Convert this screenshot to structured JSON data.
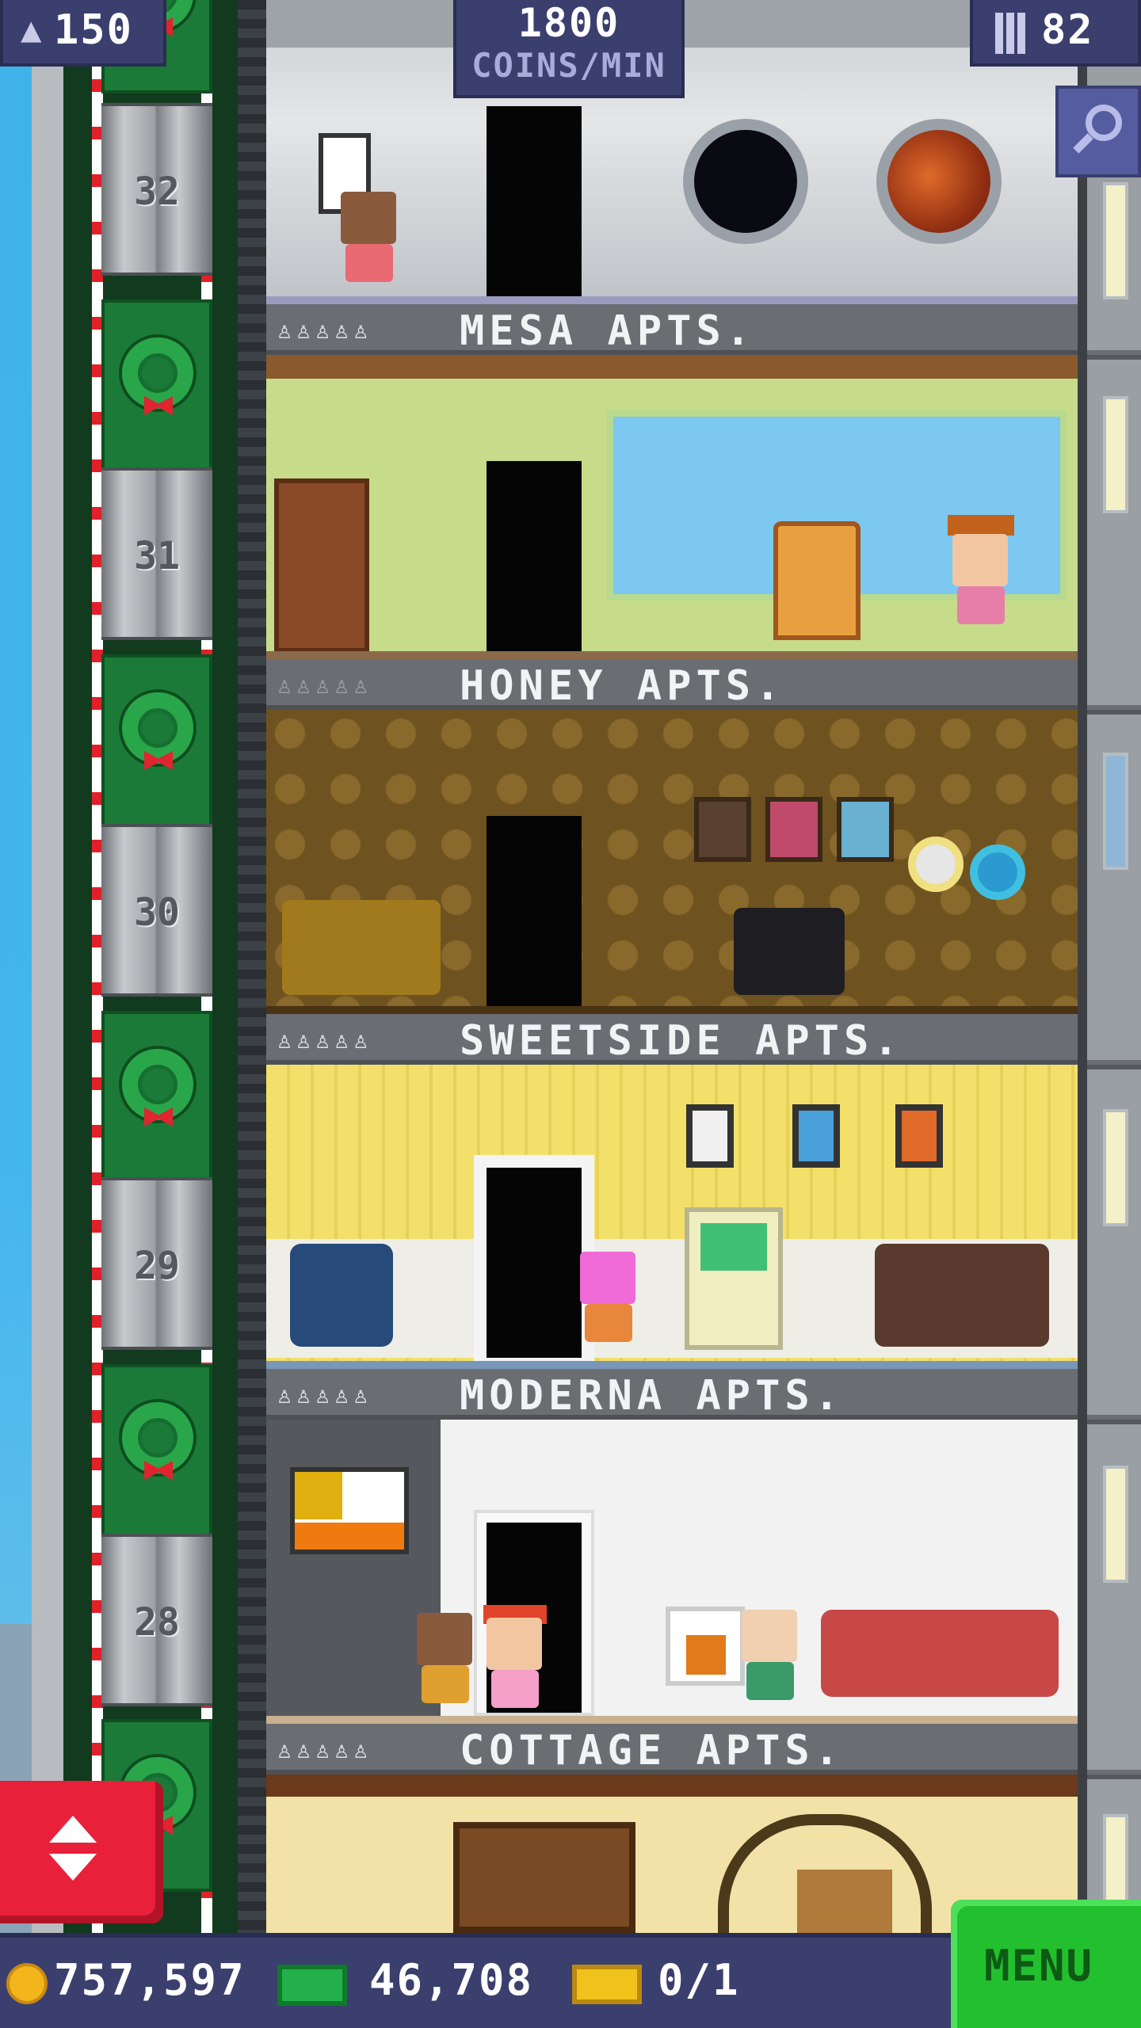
{
  "hud": {
    "population": "150",
    "coins_per_min_value": "1800",
    "coins_per_min_label": "COINS/MIN",
    "floor_count": "82"
  },
  "elevator": {
    "floor_numbers": [
      "32",
      "31",
      "30",
      "29",
      "28"
    ]
  },
  "floors": [
    {
      "name": "MESA APTS.",
      "residents": "♙♙♙♙♙"
    },
    {
      "name": "HONEY APTS.",
      "residents": "♙♙♙♙♙"
    },
    {
      "name": "SWEETSIDE APTS.",
      "residents": "♙♙♙♙♙"
    },
    {
      "name": "MODERNA APTS.",
      "residents": "♙♙♙♙♙"
    },
    {
      "name": "COTTAGE APTS.",
      "residents": "♙♙♙♙♙"
    }
  ],
  "bottom_bar": {
    "coins": "757,597",
    "bux": "46,708",
    "tickets": "0/1",
    "menu_label": "MENU"
  },
  "colors": {
    "hud_bg": "#3a3f6e",
    "menu_green": "#22c02e",
    "elevator_button_red": "#e8203a",
    "coin_gold": "#f2b51c",
    "bux_green": "#23b04a"
  }
}
